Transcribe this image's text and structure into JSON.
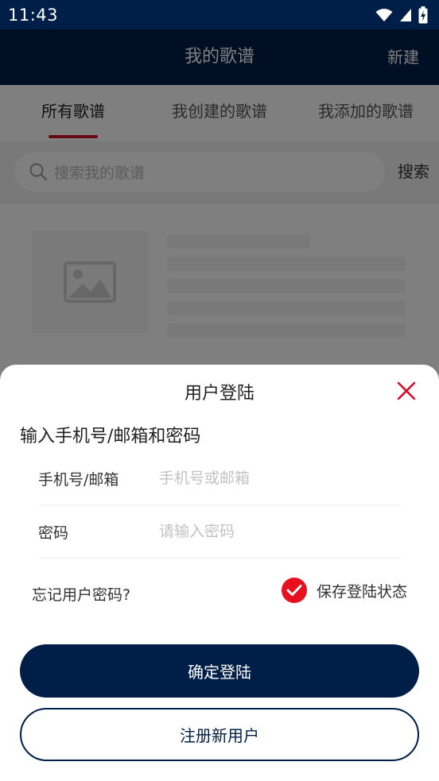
{
  "status_bar": {
    "time": "11:43",
    "icons": [
      "wifi-icon",
      "signal-icon",
      "battery-charging-icon"
    ]
  },
  "app_bar": {
    "title": "我的歌谱",
    "new_label": "新建"
  },
  "tabs": [
    {
      "label": "所有歌谱",
      "active": true
    },
    {
      "label": "我创建的歌谱",
      "active": false
    },
    {
      "label": "我添加的歌谱",
      "active": false
    }
  ],
  "search": {
    "placeholder": "搜索我的歌谱",
    "button_label": "搜索",
    "icon": "search-icon"
  },
  "login_sheet": {
    "title": "用户登陆",
    "close_icon": "close-icon",
    "subtitle": "输入手机号/邮箱和密码",
    "account_field": {
      "label": "手机号/邮箱",
      "placeholder": "手机号或邮箱",
      "value": ""
    },
    "password_field": {
      "label": "密码",
      "placeholder": "请输入密码",
      "value": ""
    },
    "forgot_label": "忘记用户密码?",
    "remember": {
      "label": "保存登陆状态",
      "checked": true
    },
    "login_button": "确定登陆",
    "register_button": "注册新用户"
  },
  "colors": {
    "primary": "#001f48",
    "accent_red": "#e8101e",
    "tab_indicator": "#d0102a"
  }
}
